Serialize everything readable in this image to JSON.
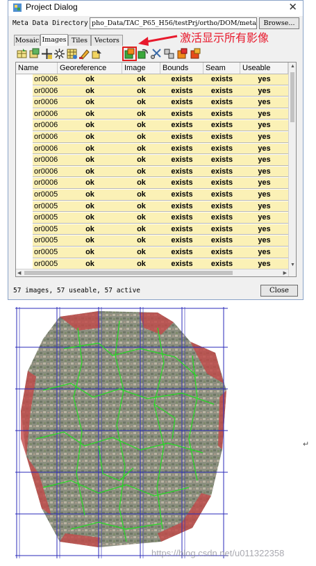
{
  "window": {
    "title": "Project Dialog",
    "close_glyph": "✕"
  },
  "meta": {
    "label": "Meta Data Directory",
    "value": "pho_Data/TAC_P65_H56/testPrj/ortho/DOM/meta",
    "browse": "Browse..."
  },
  "tabs": [
    "Mosaic",
    "Images",
    "Tiles",
    "Vectors"
  ],
  "active_tab": "Images",
  "annotation": "激活显示所有影像",
  "annotation_color": "#e8192c",
  "toolbar": {
    "icons": [
      "table-icon",
      "add-icon",
      "crosshair-icon",
      "bursting-icon",
      "grid-tool-icon",
      "pen-icon",
      "export-icon",
      "activate-all-icon",
      "refresh-icon",
      "tools-icon",
      "merge-icon",
      "ortho-icon",
      "deactivate-icon"
    ],
    "active_index": 7
  },
  "table": {
    "columns": [
      "Name",
      "Georeference",
      "Image",
      "Bounds",
      "Seam",
      "Useable"
    ],
    "rows": [
      [
        "or00069",
        "ok",
        "ok",
        "exists",
        "exists",
        "yes"
      ],
      [
        "or00068",
        "ok",
        "ok",
        "exists",
        "exists",
        "yes"
      ],
      [
        "or00067",
        "ok",
        "ok",
        "exists",
        "exists",
        "yes"
      ],
      [
        "or00066",
        "ok",
        "ok",
        "exists",
        "exists",
        "yes"
      ],
      [
        "or00065",
        "ok",
        "ok",
        "exists",
        "exists",
        "yes"
      ],
      [
        "or00064",
        "ok",
        "ok",
        "exists",
        "exists",
        "yes"
      ],
      [
        "or00063",
        "ok",
        "ok",
        "exists",
        "exists",
        "yes"
      ],
      [
        "or00062",
        "ok",
        "ok",
        "exists",
        "exists",
        "yes"
      ],
      [
        "or00061",
        "ok",
        "ok",
        "exists",
        "exists",
        "yes"
      ],
      [
        "or00060",
        "ok",
        "ok",
        "exists",
        "exists",
        "yes"
      ],
      [
        "or00059",
        "ok",
        "ok",
        "exists",
        "exists",
        "yes"
      ],
      [
        "or00058",
        "ok",
        "ok",
        "exists",
        "exists",
        "yes"
      ],
      [
        "or00057",
        "ok",
        "ok",
        "exists",
        "exists",
        "yes"
      ],
      [
        "or00056",
        "ok",
        "ok",
        "exists",
        "exists",
        "yes"
      ],
      [
        "or00055",
        "ok",
        "ok",
        "exists",
        "exists",
        "yes"
      ],
      [
        "or00054",
        "ok",
        "ok",
        "exists",
        "exists",
        "yes"
      ],
      [
        "or00053",
        "ok",
        "ok",
        "exists",
        "exists",
        "yes"
      ]
    ],
    "row_color": "#fbf1b6"
  },
  "status": "57 images, 57 useable, 57 active",
  "close_button": "Close",
  "map": {
    "grid_color": "#2a2ab8",
    "seam_color": "#22dd22",
    "mask_color": "#c24848"
  },
  "cursor_mark": "↵",
  "watermark": "https://blog.csdn.net/u011322358"
}
